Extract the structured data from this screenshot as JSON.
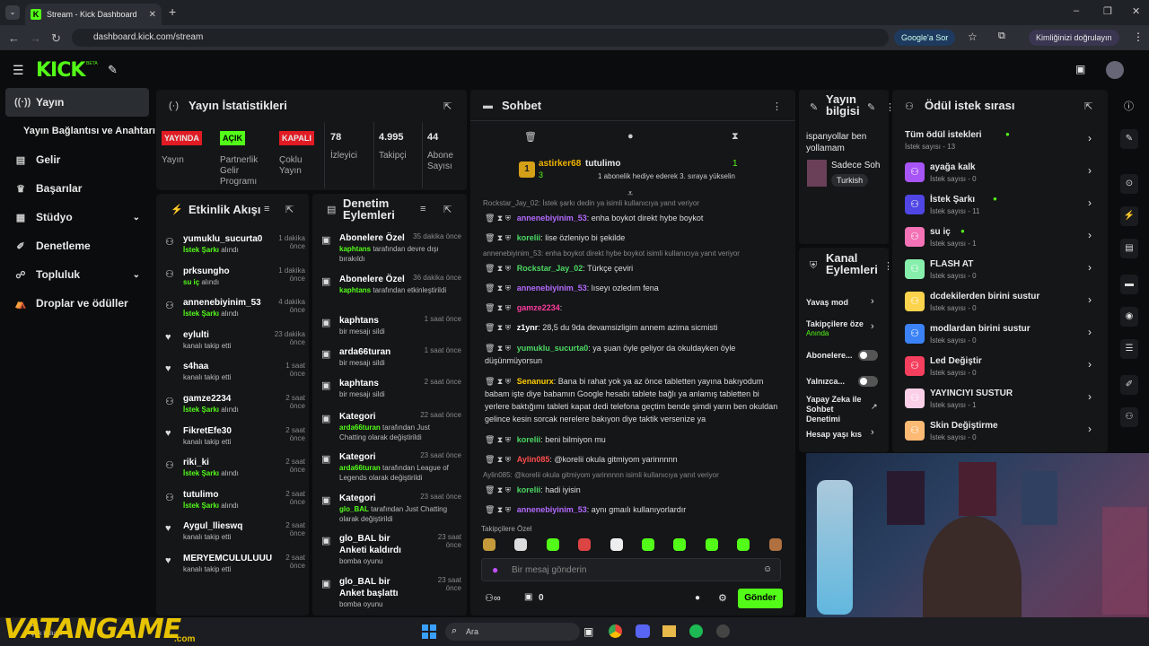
{
  "browser": {
    "tab_title": "Stream - Kick Dashboard",
    "url": "dashboard.kick.com/stream",
    "google_button": "Google'a Sor",
    "identity_button": "Kimliğinizi doğrulayın"
  },
  "kick": {
    "logo": "KICK",
    "beta": "BETA"
  },
  "sidebar": {
    "items": [
      {
        "label": "Yayın"
      },
      {
        "label": "Yayın Bağlantısı ve Anahtarı"
      },
      {
        "label": "Gelir"
      },
      {
        "label": "Başarılar"
      },
      {
        "label": "Stüdyo"
      },
      {
        "label": "Denetleme"
      },
      {
        "label": "Topluluk"
      },
      {
        "label": "Droplar ve ödüller"
      }
    ]
  },
  "stats": {
    "title": "Yayın İstatistikleri",
    "badges": [
      {
        "value": "YAYINDA",
        "label": "Yayın",
        "color": "#e01b24"
      },
      {
        "value": "AÇIK",
        "label": "Partnerlik Gelir Programı",
        "color": "#53fc18"
      },
      {
        "value": "KAPALI",
        "label": "Çoklu Yayın",
        "color": "#e01b24"
      }
    ],
    "numbers": [
      {
        "value": "78",
        "label": "İzleyici"
      },
      {
        "value": "4.995",
        "label": "Takipçi"
      },
      {
        "value": "44",
        "label": "Abone Sayısı"
      }
    ]
  },
  "activity": {
    "title": "Etkinlik Akışı",
    "items": [
      {
        "name": "yumuklu_sucurta0",
        "action": "İstek Şarkı",
        "suffix": "alındı",
        "time": "1 dakika önce",
        "icon": "gift"
      },
      {
        "name": "prksungho",
        "action": "su iç",
        "suffix": "alındı",
        "time": "1 dakika önce",
        "icon": "gift"
      },
      {
        "name": "annenebiyinim_53",
        "action": "İstek Şarkı",
        "suffix": "alındı",
        "time": "4 dakika önce",
        "icon": "gift"
      },
      {
        "name": "eylulti",
        "action": "",
        "suffix": "kanalı takip etti",
        "time": "23 dakika önce",
        "icon": "heart"
      },
      {
        "name": "s4haa",
        "action": "",
        "suffix": "kanalı takip etti",
        "time": "1 saat önce",
        "icon": "heart"
      },
      {
        "name": "gamze2234",
        "action": "İstek Şarkı",
        "suffix": "alındı",
        "time": "2 saat önce",
        "icon": "gift"
      },
      {
        "name": "FikretEfe30",
        "action": "",
        "suffix": "kanalı takip etti",
        "time": "2 saat önce",
        "icon": "heart"
      },
      {
        "name": "riki_ki",
        "action": "İstek Şarkı",
        "suffix": "alındı",
        "time": "2 saat önce",
        "icon": "gift"
      },
      {
        "name": "tutulimo",
        "action": "İstek Şarkı",
        "suffix": "alındı",
        "time": "2 saat önce",
        "icon": "gift"
      },
      {
        "name": "Aygul_llieswq",
        "action": "",
        "suffix": "kanalı takip etti",
        "time": "2 saat önce",
        "icon": "heart"
      },
      {
        "name": "MERYEMCULULUUU",
        "action": "",
        "suffix": "kanalı takip etti",
        "time": "2 saat önce",
        "icon": "heart"
      }
    ]
  },
  "modactions": {
    "title": "Denetim Eylemleri",
    "items": [
      {
        "title": "Abonelere Özel",
        "actor": "kaphtans",
        "text": "tarafından devre dışı bırakıldı",
        "time": "35 dakika önce"
      },
      {
        "title": "Abonelere Özel",
        "actor": "kaphtans",
        "text": "tarafından etkinleştirildi",
        "time": "36 dakika önce"
      },
      {
        "title": "kaphtans",
        "actor": "",
        "text": "bir mesajı sildi",
        "time": "1 saat önce"
      },
      {
        "title": "arda66turan",
        "actor": "",
        "text": "bir mesajı sildi",
        "time": "1 saat önce"
      },
      {
        "title": "kaphtans",
        "actor": "",
        "text": "bir mesajı sildi",
        "time": "2 saat önce"
      },
      {
        "title": "Kategori",
        "actor": "arda66turan",
        "text": "tarafından Just Chatting olarak değiştirildi",
        "time": "22 saat önce"
      },
      {
        "title": "Kategori",
        "actor": "arda66turan",
        "text": "tarafından League of Legends olarak değiştirildi",
        "time": "23 saat önce"
      },
      {
        "title": "Kategori",
        "actor": "glo_BAL",
        "text": "tarafından Just Chatting olarak değiştirildi",
        "time": "23 saat önce"
      },
      {
        "title": "glo_BAL bir Anketi kaldırdı",
        "actor": "",
        "text": "bomba oyunu",
        "time": "23 saat önce"
      },
      {
        "title": "glo_BAL bir Anket başlattı",
        "actor": "",
        "text": "bomba oyunu",
        "time": "23 saat önce"
      }
    ]
  },
  "chat": {
    "title": "Sohbet",
    "pinned": {
      "gifter": "astirker68",
      "count": "3",
      "recipient": "tutulimo",
      "gift_count": "1",
      "text": "1 abonelik hediye ederek 3. sıraya yükselin"
    },
    "messages": [
      {
        "reply": "Rockstar_Jay_02: İstek şarkı dedin ya isimli kullanıcıya yanıt veriyor",
        "user": "annenebiyinim_53",
        "color": "#b36bff",
        "text": "enha boykot direkt hybe boykot"
      },
      {
        "reply": "",
        "user": "korelii",
        "color": "#4cd964",
        "text": "lise özleniyo bi şekilde"
      },
      {
        "reply": "annenebiyinim_53: enha boykot direkt hybe boykot isimli kullanıcıya yanıt veriyor",
        "user": "Rockstar_Jay_02",
        "color": "#4cd964",
        "text": "Türkçe çeviri"
      },
      {
        "reply": "",
        "user": "annenebiyinim_53",
        "color": "#b36bff",
        "text": "lıseyı ozledım fena"
      },
      {
        "reply": "",
        "user": "gamze2234",
        "color": "#ff3ca0",
        "text": ""
      },
      {
        "reply": "",
        "user": "z1ynr",
        "color": "#ffffff",
        "text": "28,5 du 9da devamsizligim annem azima sicmisti"
      },
      {
        "reply": "",
        "user": "yumuklu_sucurta0",
        "color": "#4cd964",
        "text": "ya şuan öyle geliyor da okuldayken öyle düşünmüyorsun"
      },
      {
        "reply": "",
        "user": "Senanurx",
        "color": "#ffcc00",
        "text": "Bana bi rahat yok ya az önce tabletten yayına bakıyodum babam işte diye babamın Google hesabı tablete bağlı ya anlamış tabletten bi yerlere baktığımı tableti kapat dedi telefona geçtim bende şimdi yarın ben okuldan gelince kesin sorcak nerelere bakıyon diye taktik versenize ya"
      },
      {
        "reply": "",
        "user": "korelii",
        "color": "#4cd964",
        "text": "beni bilmiyon mu"
      },
      {
        "reply": "",
        "user": "Aylin085",
        "color": "#ff4d4d",
        "text": "@korelii okula gitmiyom yarinnnnn"
      },
      {
        "reply": "Aylin085: @korelii okula gitmiyom yarinnnnn isimli kullanıcıya yanıt veriyor",
        "user": "korelii",
        "color": "#4cd964",
        "text": "hadi iyisin"
      },
      {
        "reply": "",
        "user": "annenebiyinim_53",
        "color": "#b36bff",
        "text": "aynı gmaılı kullanıyorlardır"
      }
    ],
    "emote_label": "Takipçilere Özel",
    "input_placeholder": "Bir mesaj gönderin",
    "points": "0",
    "send": "Gönder"
  },
  "streaminfo": {
    "title": "Yayın bilgisi",
    "text": "ispanyollar ben yollamam",
    "recent": "Sadece Soh",
    "lang": "Turkish"
  },
  "channelactions": {
    "title": "Kanal Eylemleri",
    "items": [
      {
        "label": "Yavaş mod",
        "sub": ""
      },
      {
        "label": "Takipçilere öze",
        "sub": "Anında"
      },
      {
        "label": "Abonelere...",
        "sub": ""
      },
      {
        "label": "Yalnızca...",
        "sub": ""
      },
      {
        "label": "Yapay Zeka ile Sohbet Denetimi",
        "sub": ""
      },
      {
        "label": "Hesap yaşı kıs",
        "sub": ""
      }
    ]
  },
  "rewards": {
    "title": "Ödül istek sırası",
    "items": [
      {
        "name": "Tüm ödül istekleri",
        "count": "İstek sayısı - 13",
        "color": "",
        "dot": true
      },
      {
        "name": "ayağa kalk",
        "count": "İstek sayısı - 0",
        "color": "#a855f7",
        "dot": false
      },
      {
        "name": "İstek Şarkı",
        "count": "İstek sayısı - 11",
        "color": "#4f46e5",
        "dot": true
      },
      {
        "name": "su iç",
        "count": "İstek sayısı - 1",
        "color": "#f472b6",
        "dot": true
      },
      {
        "name": "FLASH AT",
        "count": "İstek sayısı - 0",
        "color": "#86efac",
        "dot": false
      },
      {
        "name": "dcdekilerden birini sustur",
        "count": "İstek sayısı - 0",
        "color": "#fcd34d",
        "dot": false
      },
      {
        "name": "modlardan birini sustur",
        "count": "İstek sayısı - 0",
        "color": "#3b82f6",
        "dot": false
      },
      {
        "name": "Led Değiştir",
        "count": "İstek sayısı - 0",
        "color": "#f43f5e",
        "dot": false
      },
      {
        "name": "YAYINCIYI SUSTUR",
        "count": "İstek sayısı - 1",
        "color": "#fbcfe8",
        "dot": false
      },
      {
        "name": "Skin Değiştirme",
        "count": "İstek sayısı - 0",
        "color": "#fdba74",
        "dot": false
      }
    ]
  },
  "taskbar": {
    "search": "Ara",
    "widget": "10",
    "widget_sub": "Çok bulutlu",
    "watermark": "VATANGAME",
    "watermark_sub": ".com"
  }
}
